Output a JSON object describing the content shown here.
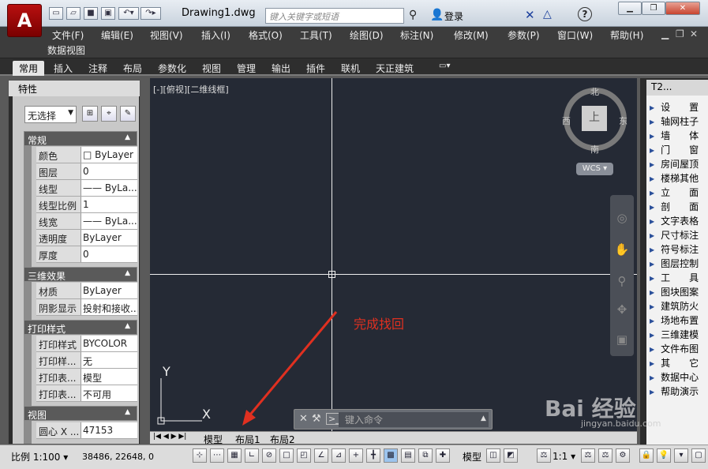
{
  "title_bar": {
    "app_button": "A",
    "document_title": "Drawing1.dwg",
    "search_placeholder": "键入关键字或短语",
    "login": "登录",
    "quick_access_icons": [
      "new-icon",
      "open-icon",
      "save-icon",
      "saveas-icon",
      "print-icon",
      "undo-icon",
      "redo-icon"
    ]
  },
  "window_controls": {
    "minimize": "▁",
    "restore": "❐",
    "close": "✕",
    "doc_minimize": "▁",
    "doc_restore": "❐",
    "doc_close": "✕"
  },
  "menu": {
    "items": [
      "文件(F)",
      "编辑(E)",
      "视图(V)",
      "插入(I)",
      "格式(O)",
      "工具(T)",
      "绘图(D)",
      "标注(N)",
      "修改(M)",
      "参数(P)",
      "窗口(W)",
      "帮助(H)"
    ],
    "second_row": "数据视图"
  },
  "ribbon_tabs": [
    "常用",
    "插入",
    "注释",
    "布局",
    "参数化",
    "视图",
    "管理",
    "输出",
    "插件",
    "联机",
    "天正建筑"
  ],
  "properties": {
    "title": "特性",
    "selection": "无选择",
    "sections": [
      {
        "name": "常规",
        "rows": [
          [
            "颜色",
            "□ ByLayer"
          ],
          [
            "图层",
            "0"
          ],
          [
            "线型",
            "—— ByLa..."
          ],
          [
            "线型比例",
            "1"
          ],
          [
            "线宽",
            "—— ByLa..."
          ],
          [
            "透明度",
            "ByLayer"
          ],
          [
            "厚度",
            "0"
          ]
        ]
      },
      {
        "name": "三维效果",
        "rows": [
          [
            "材质",
            "ByLayer"
          ],
          [
            "阴影显示",
            "投射和接收..."
          ]
        ]
      },
      {
        "name": "打印样式",
        "rows": [
          [
            "打印样式",
            "BYCOLOR"
          ],
          [
            "打印样...",
            "无"
          ],
          [
            "打印表...",
            "模型"
          ],
          [
            "打印表...",
            "不可用"
          ]
        ]
      },
      {
        "name": "视图",
        "rows": [
          [
            "圆心 X ...",
            "47153"
          ]
        ]
      }
    ]
  },
  "viewport": {
    "label": "[-][俯视][二维线框]",
    "viewcube": {
      "face": "上",
      "north": "北",
      "south": "南",
      "east": "东",
      "west": "西"
    },
    "wcs": "WCS ▾",
    "ucs": {
      "x": "X",
      "y": "Y"
    },
    "annotation": "完成找回",
    "command_placeholder": "键入命令"
  },
  "layout_tabs": {
    "model": "模型",
    "layout1": "布局1",
    "layout2": "布局2"
  },
  "tool_palette": {
    "title": "T2...",
    "items": [
      "设　　置",
      "轴网柱子",
      "墙　　体",
      "门　　窗",
      "房间屋顶",
      "楼梯其他",
      "立　　面",
      "剖　　面",
      "文字表格",
      "尺寸标注",
      "符号标注",
      "图层控制",
      "工　　具",
      "图块图案",
      "建筑防火",
      "场地布置",
      "三维建模",
      "文件布图",
      "其　　它",
      "数据中心",
      "帮助演示"
    ]
  },
  "status_bar": {
    "scale": "比例 1:100 ▾",
    "coords": "38486, 22648, 0",
    "model": "模型",
    "annotation_scale": "1:1 ▾"
  },
  "watermark": {
    "brand": "Bai  经验",
    "url": "jingyan.baidu.com"
  },
  "colors": {
    "drawing_bg": "#252a35",
    "annotation": "#e03020",
    "app_red": "#b81010"
  }
}
